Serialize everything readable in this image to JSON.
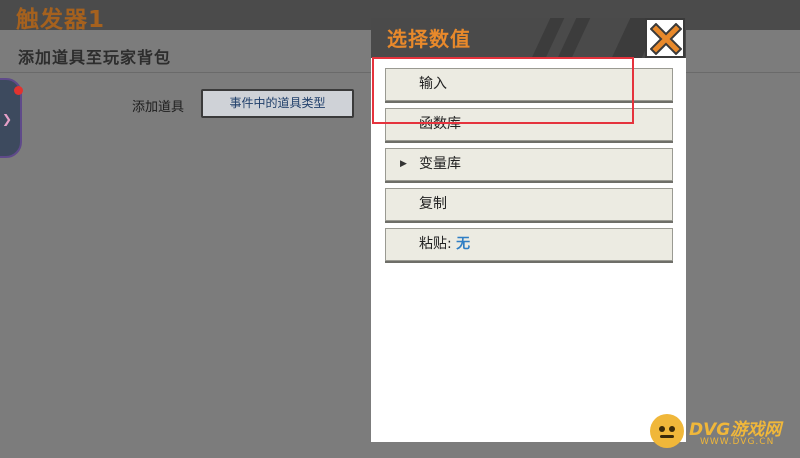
{
  "window_title": "触发器1",
  "section_title": "添加道具至玩家背包",
  "form": {
    "add_item_label": "添加道具",
    "add_item_value": "事件中的道具类型"
  },
  "dialog": {
    "title": "选择数值",
    "items": [
      {
        "label": "输入",
        "has_arrow": false
      },
      {
        "label": "函数库",
        "has_arrow": false
      },
      {
        "label": "变量库",
        "has_arrow": true
      },
      {
        "label": "复制",
        "has_arrow": false
      },
      {
        "label": "粘贴:",
        "value": "无",
        "has_arrow": false
      }
    ]
  },
  "watermark": {
    "text": "DVG游戏网",
    "subtext": "WWW.DVG.CN"
  },
  "colors": {
    "title_orange": "#e8892b",
    "highlight_red": "#e5333d",
    "paste_value_blue": "#2f7ec4"
  },
  "icons": {
    "close": "close-icon",
    "submenu_arrow": "triangle-right-icon"
  }
}
